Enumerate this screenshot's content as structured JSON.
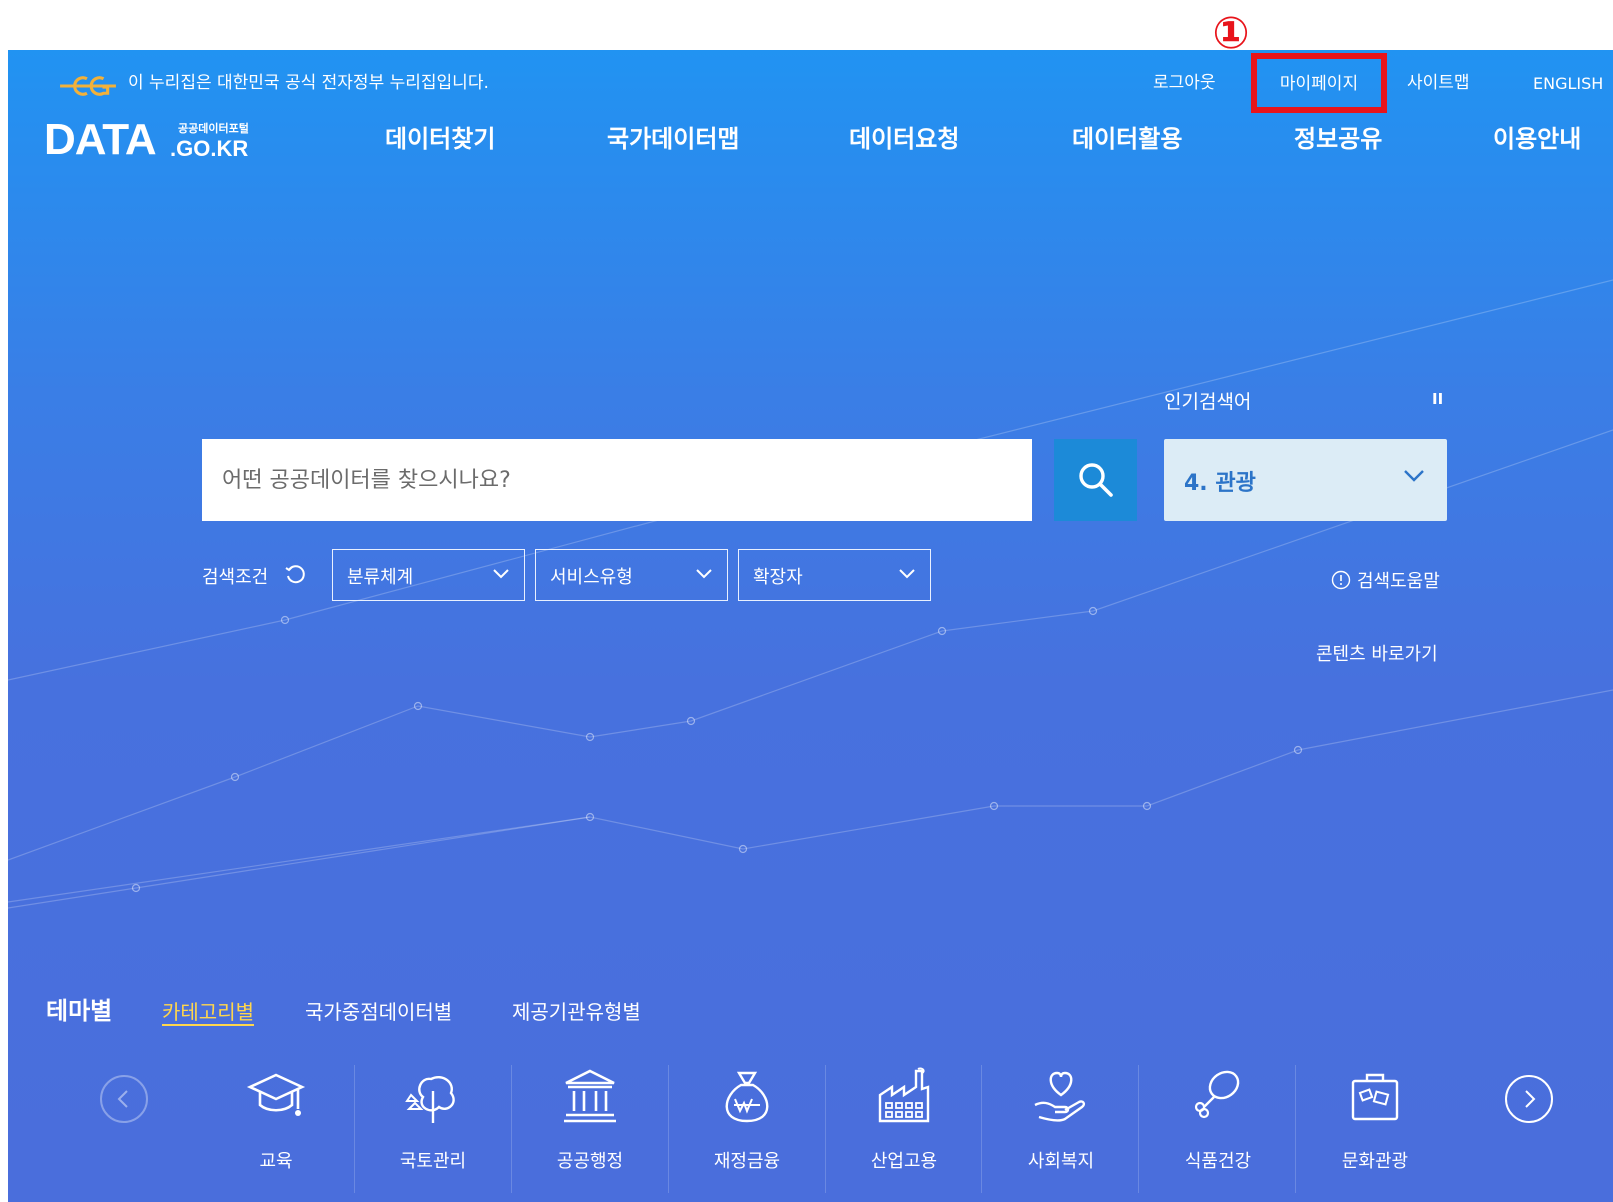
{
  "annotation": {
    "marker": "①"
  },
  "gov_bar": {
    "notice": "이 누리집은 대한민국 공식 전자정부 누리집입니다."
  },
  "utility": {
    "logout": "로그아웃",
    "mypage": "마이페이지",
    "sitemap": "사이트맵",
    "english": "ENGLISH"
  },
  "brand": {
    "main": "DATA",
    "ko": "공공데이터포털",
    "sub": ".GO.KR"
  },
  "gnb": [
    "데이터찾기",
    "국가데이터맵",
    "데이터요청",
    "데이터활용",
    "정보공유",
    "이용안내"
  ],
  "search": {
    "placeholder": "어떤 공공데이터를 찾으시나요?"
  },
  "popular": {
    "label": "인기검색어",
    "pause": "II",
    "value": "4. 관광"
  },
  "conditions": {
    "label": "검색조건",
    "selects": [
      "분류체계",
      "서비스유형",
      "확장자"
    ]
  },
  "links": {
    "help": "검색도움말",
    "content": "콘텐츠 바로가기"
  },
  "theme": {
    "title": "테마별",
    "tabs": [
      "카테고리별",
      "국가중점데이터별",
      "제공기관유형별"
    ],
    "active_tab": "카테고리별"
  },
  "categories": [
    "교육",
    "국토관리",
    "공공행정",
    "재정금융",
    "산업고용",
    "사회복지",
    "식품건강",
    "문화관광"
  ],
  "colors": {
    "hero_top": "#2193f2",
    "hero_bottom": "#4a6edc",
    "search_button": "#1c8ad8",
    "popular_box": "#dcecf6",
    "highlight": "#e8141b",
    "active_tab": "#ffd64c"
  }
}
